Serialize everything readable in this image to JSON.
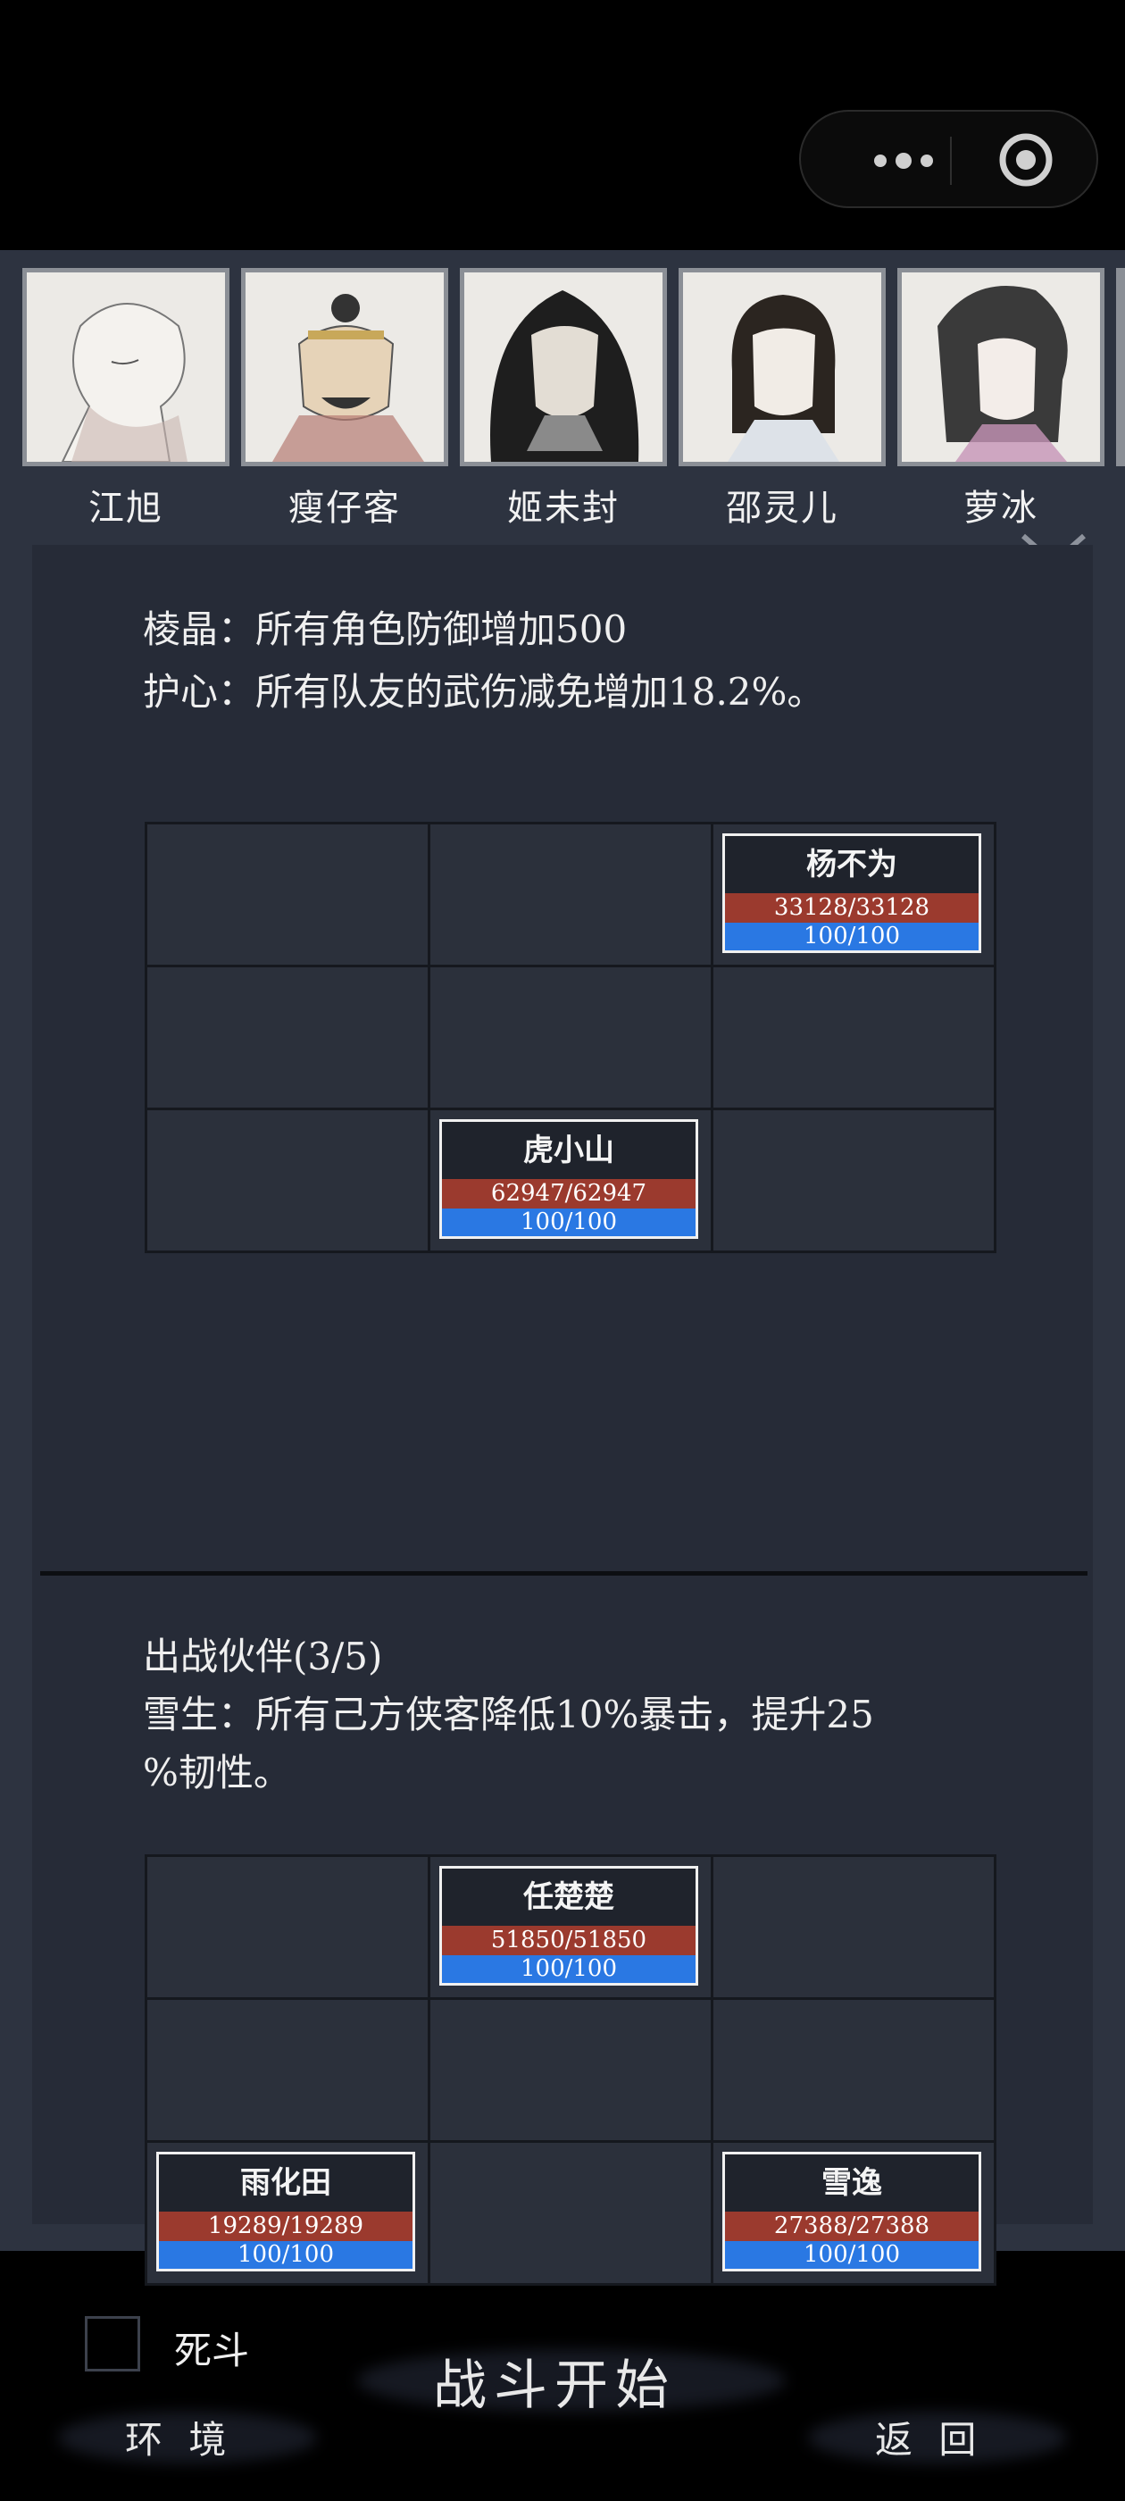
{
  "system": {
    "menu_icon": "more-dots-icon",
    "close_icon": "target-icon"
  },
  "heroes": [
    {
      "name": "江旭"
    },
    {
      "name": "瘦仔客"
    },
    {
      "name": "姬未封"
    },
    {
      "name": "邵灵儿"
    },
    {
      "name": "萝冰"
    }
  ],
  "enemy": {
    "buff1": "棱晶：所有角色防御增加500",
    "buff2": "护心：所有队友的武伤减免增加18.2%。",
    "units": [
      {
        "name": "杨不为",
        "hp": "33128/33128",
        "mp": "100/100"
      },
      {
        "name": "虎小山",
        "hp": "62947/62947",
        "mp": "100/100"
      }
    ]
  },
  "ally": {
    "header": "出战伙伴(3/5)",
    "buff_line1": "雪生：所有己方侠客降低10%暴击，提升25",
    "buff_line2": "%韧性。",
    "units": [
      {
        "name": "任楚楚",
        "hp": "51850/51850",
        "mp": "100/100"
      },
      {
        "name": "雨化田",
        "hp": "19289/19289",
        "mp": "100/100"
      },
      {
        "name": "雪逸",
        "hp": "27388/27388",
        "mp": "100/100"
      }
    ]
  },
  "controls": {
    "death_match": "死斗",
    "start": "战斗开始",
    "environment": "环 境",
    "back": "返 回"
  },
  "colors": {
    "bg": "#2d3340",
    "panel": "#262b37",
    "hp": "#9b3a2e",
    "mp": "#2a78e3"
  }
}
